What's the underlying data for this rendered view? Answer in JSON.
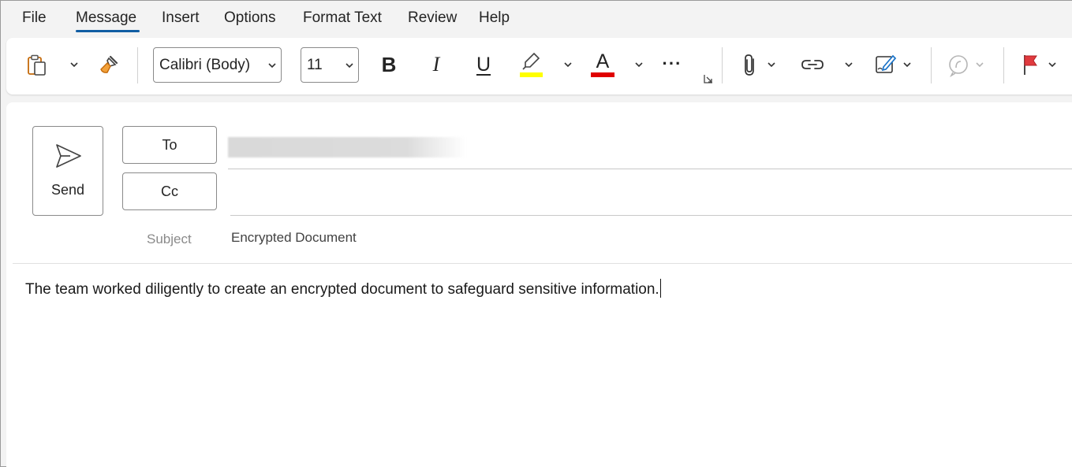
{
  "tabs": {
    "file": "File",
    "message": "Message",
    "insert": "Insert",
    "options": "Options",
    "format_text": "Format Text",
    "review": "Review",
    "help": "Help"
  },
  "ribbon": {
    "font_name": "Calibri (Body)",
    "font_size": "11",
    "bold_glyph": "B",
    "italic_glyph": "I",
    "underline_glyph": "U",
    "font_color_glyph": "A",
    "more_glyph": "···",
    "highlight_color": "#ffff00",
    "font_color": "#e00000"
  },
  "compose": {
    "send_label": "Send",
    "to_label": "To",
    "cc_label": "Cc",
    "subject_label": "Subject",
    "subject_value": "Encrypted Document",
    "body_text": "The team worked diligently to create an encrypted document to safeguard sensitive information."
  },
  "colors": {
    "accent": "#115ea3",
    "flag": "#e03a3e"
  }
}
